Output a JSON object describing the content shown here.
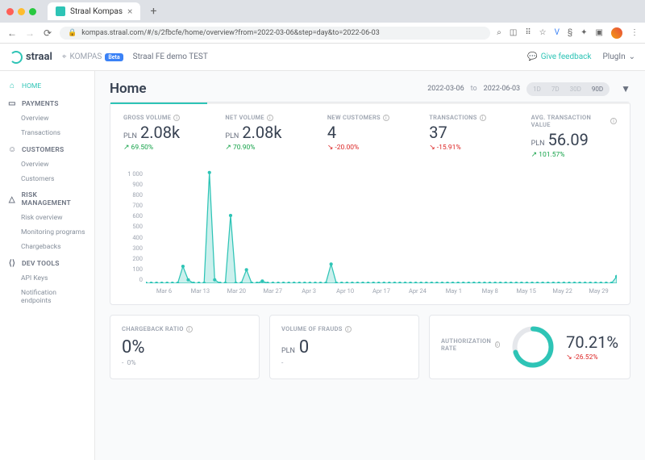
{
  "browser": {
    "tab_title": "Straal Kompas",
    "url": "kompas.straal.com/#/s/2fbcfe/home/overview?from=2022-03-06&step=day&to=2022-06-03"
  },
  "header": {
    "brand": "straal",
    "product": "KOMPAS",
    "beta": "Beta",
    "title": "Straal FE demo TEST",
    "feedback": "Give feedback",
    "plugin": "PlugIn"
  },
  "sidebar": {
    "home": "HOME",
    "payments": "PAYMENTS",
    "payments_items": [
      "Overview",
      "Transactions"
    ],
    "customers": "CUSTOMERS",
    "customers_items": [
      "Overview",
      "Customers"
    ],
    "risk": "RISK MANAGEMENT",
    "risk_items": [
      "Risk overview",
      "Monitoring programs",
      "Chargebacks"
    ],
    "dev": "DEV TOOLS",
    "dev_items": [
      "API Keys",
      "Notification endpoints"
    ]
  },
  "page": {
    "title": "Home",
    "date_from": "2022-03-06",
    "date_to": "2022-06-03",
    "date_sep": "to",
    "ranges": [
      "1D",
      "7D",
      "30D",
      "90D"
    ]
  },
  "kpis": [
    {
      "label": "GROSS VOLUME",
      "currency": "PLN",
      "value": "2.08k",
      "delta": "69.50%",
      "dir": "up"
    },
    {
      "label": "NET VOLUME",
      "currency": "PLN",
      "value": "2.08k",
      "delta": "70.90%",
      "dir": "up"
    },
    {
      "label": "NEW CUSTOMERS",
      "currency": "",
      "value": "4",
      "delta": "-20.00%",
      "dir": "down"
    },
    {
      "label": "TRANSACTIONS",
      "currency": "",
      "value": "37",
      "delta": "-15.91%",
      "dir": "down"
    },
    {
      "label": "AVG. TRANSACTION VALUE",
      "currency": "PLN",
      "value": "56.09",
      "delta": "101.57%",
      "dir": "up"
    }
  ],
  "chart_data": {
    "type": "area",
    "title": "",
    "ylabel": "",
    "ylim": [
      0,
      1000
    ],
    "y_ticks": [
      "1 000",
      "900",
      "800",
      "700",
      "600",
      "500",
      "400",
      "300",
      "200",
      "100",
      "0"
    ],
    "x_ticks": [
      "Mar 6",
      "Mar 13",
      "Mar 20",
      "Mar 27",
      "Apr 3",
      "Apr 10",
      "Apr 17",
      "Apr 24",
      "May 1",
      "May 8",
      "May 15",
      "May 22",
      "May 29"
    ],
    "x": [
      "2022-03-06",
      "2022-03-07",
      "2022-03-08",
      "2022-03-09",
      "2022-03-10",
      "2022-03-11",
      "2022-03-12",
      "2022-03-13",
      "2022-03-14",
      "2022-03-15",
      "2022-03-16",
      "2022-03-17",
      "2022-03-18",
      "2022-03-19",
      "2022-03-20",
      "2022-03-21",
      "2022-03-22",
      "2022-03-23",
      "2022-03-24",
      "2022-03-25",
      "2022-03-26",
      "2022-03-27",
      "2022-03-28",
      "2022-03-29",
      "2022-03-30",
      "2022-03-31",
      "2022-04-01",
      "2022-04-02",
      "2022-04-03",
      "2022-04-04",
      "2022-04-05",
      "2022-04-06",
      "2022-04-07",
      "2022-04-08",
      "2022-04-09",
      "2022-04-10",
      "2022-04-11",
      "2022-04-12",
      "2022-04-13",
      "2022-04-14",
      "2022-04-15",
      "2022-04-16",
      "2022-04-17",
      "2022-04-18",
      "2022-04-19",
      "2022-04-20",
      "2022-04-21",
      "2022-04-22",
      "2022-04-23",
      "2022-04-24",
      "2022-04-25",
      "2022-04-26",
      "2022-04-27",
      "2022-04-28",
      "2022-04-29",
      "2022-04-30",
      "2022-05-01",
      "2022-05-02",
      "2022-05-03",
      "2022-05-04",
      "2022-05-05",
      "2022-05-06",
      "2022-05-07",
      "2022-05-08",
      "2022-05-09",
      "2022-05-10",
      "2022-05-11",
      "2022-05-12",
      "2022-05-13",
      "2022-05-14",
      "2022-05-15",
      "2022-05-16",
      "2022-05-17",
      "2022-05-18",
      "2022-05-19",
      "2022-05-20",
      "2022-05-21",
      "2022-05-22",
      "2022-05-23",
      "2022-05-24",
      "2022-05-25",
      "2022-05-26",
      "2022-05-27",
      "2022-05-28",
      "2022-05-29",
      "2022-05-30",
      "2022-05-31",
      "2022-06-01",
      "2022-06-02",
      "2022-06-03"
    ],
    "values": [
      0,
      0,
      0,
      0,
      0,
      0,
      0,
      150,
      30,
      0,
      0,
      0,
      980,
      30,
      0,
      0,
      600,
      0,
      0,
      120,
      0,
      0,
      20,
      0,
      0,
      0,
      0,
      0,
      0,
      0,
      0,
      0,
      0,
      0,
      0,
      170,
      0,
      0,
      0,
      0,
      0,
      0,
      0,
      0,
      0,
      0,
      0,
      0,
      0,
      0,
      0,
      0,
      0,
      0,
      0,
      0,
      0,
      0,
      0,
      0,
      0,
      0,
      0,
      0,
      0,
      0,
      0,
      0,
      0,
      0,
      0,
      0,
      0,
      0,
      0,
      0,
      0,
      0,
      0,
      0,
      0,
      0,
      0,
      0,
      0,
      0,
      0,
      0,
      0,
      60
    ]
  },
  "bottom": {
    "cbr_label": "CHARGEBACK RATIO",
    "cbr_value": "0%",
    "cbr_sub_dash": "-",
    "cbr_sub": "0%",
    "vof_label": "VOLUME OF FRAUDS",
    "vof_currency": "PLN",
    "vof_value": "0",
    "vof_sub": "-",
    "auth_label": "AUTHORIZATION RATE",
    "auth_value": "70.21%",
    "auth_delta": "-26.52%",
    "auth_ring_pct": 70.21
  }
}
